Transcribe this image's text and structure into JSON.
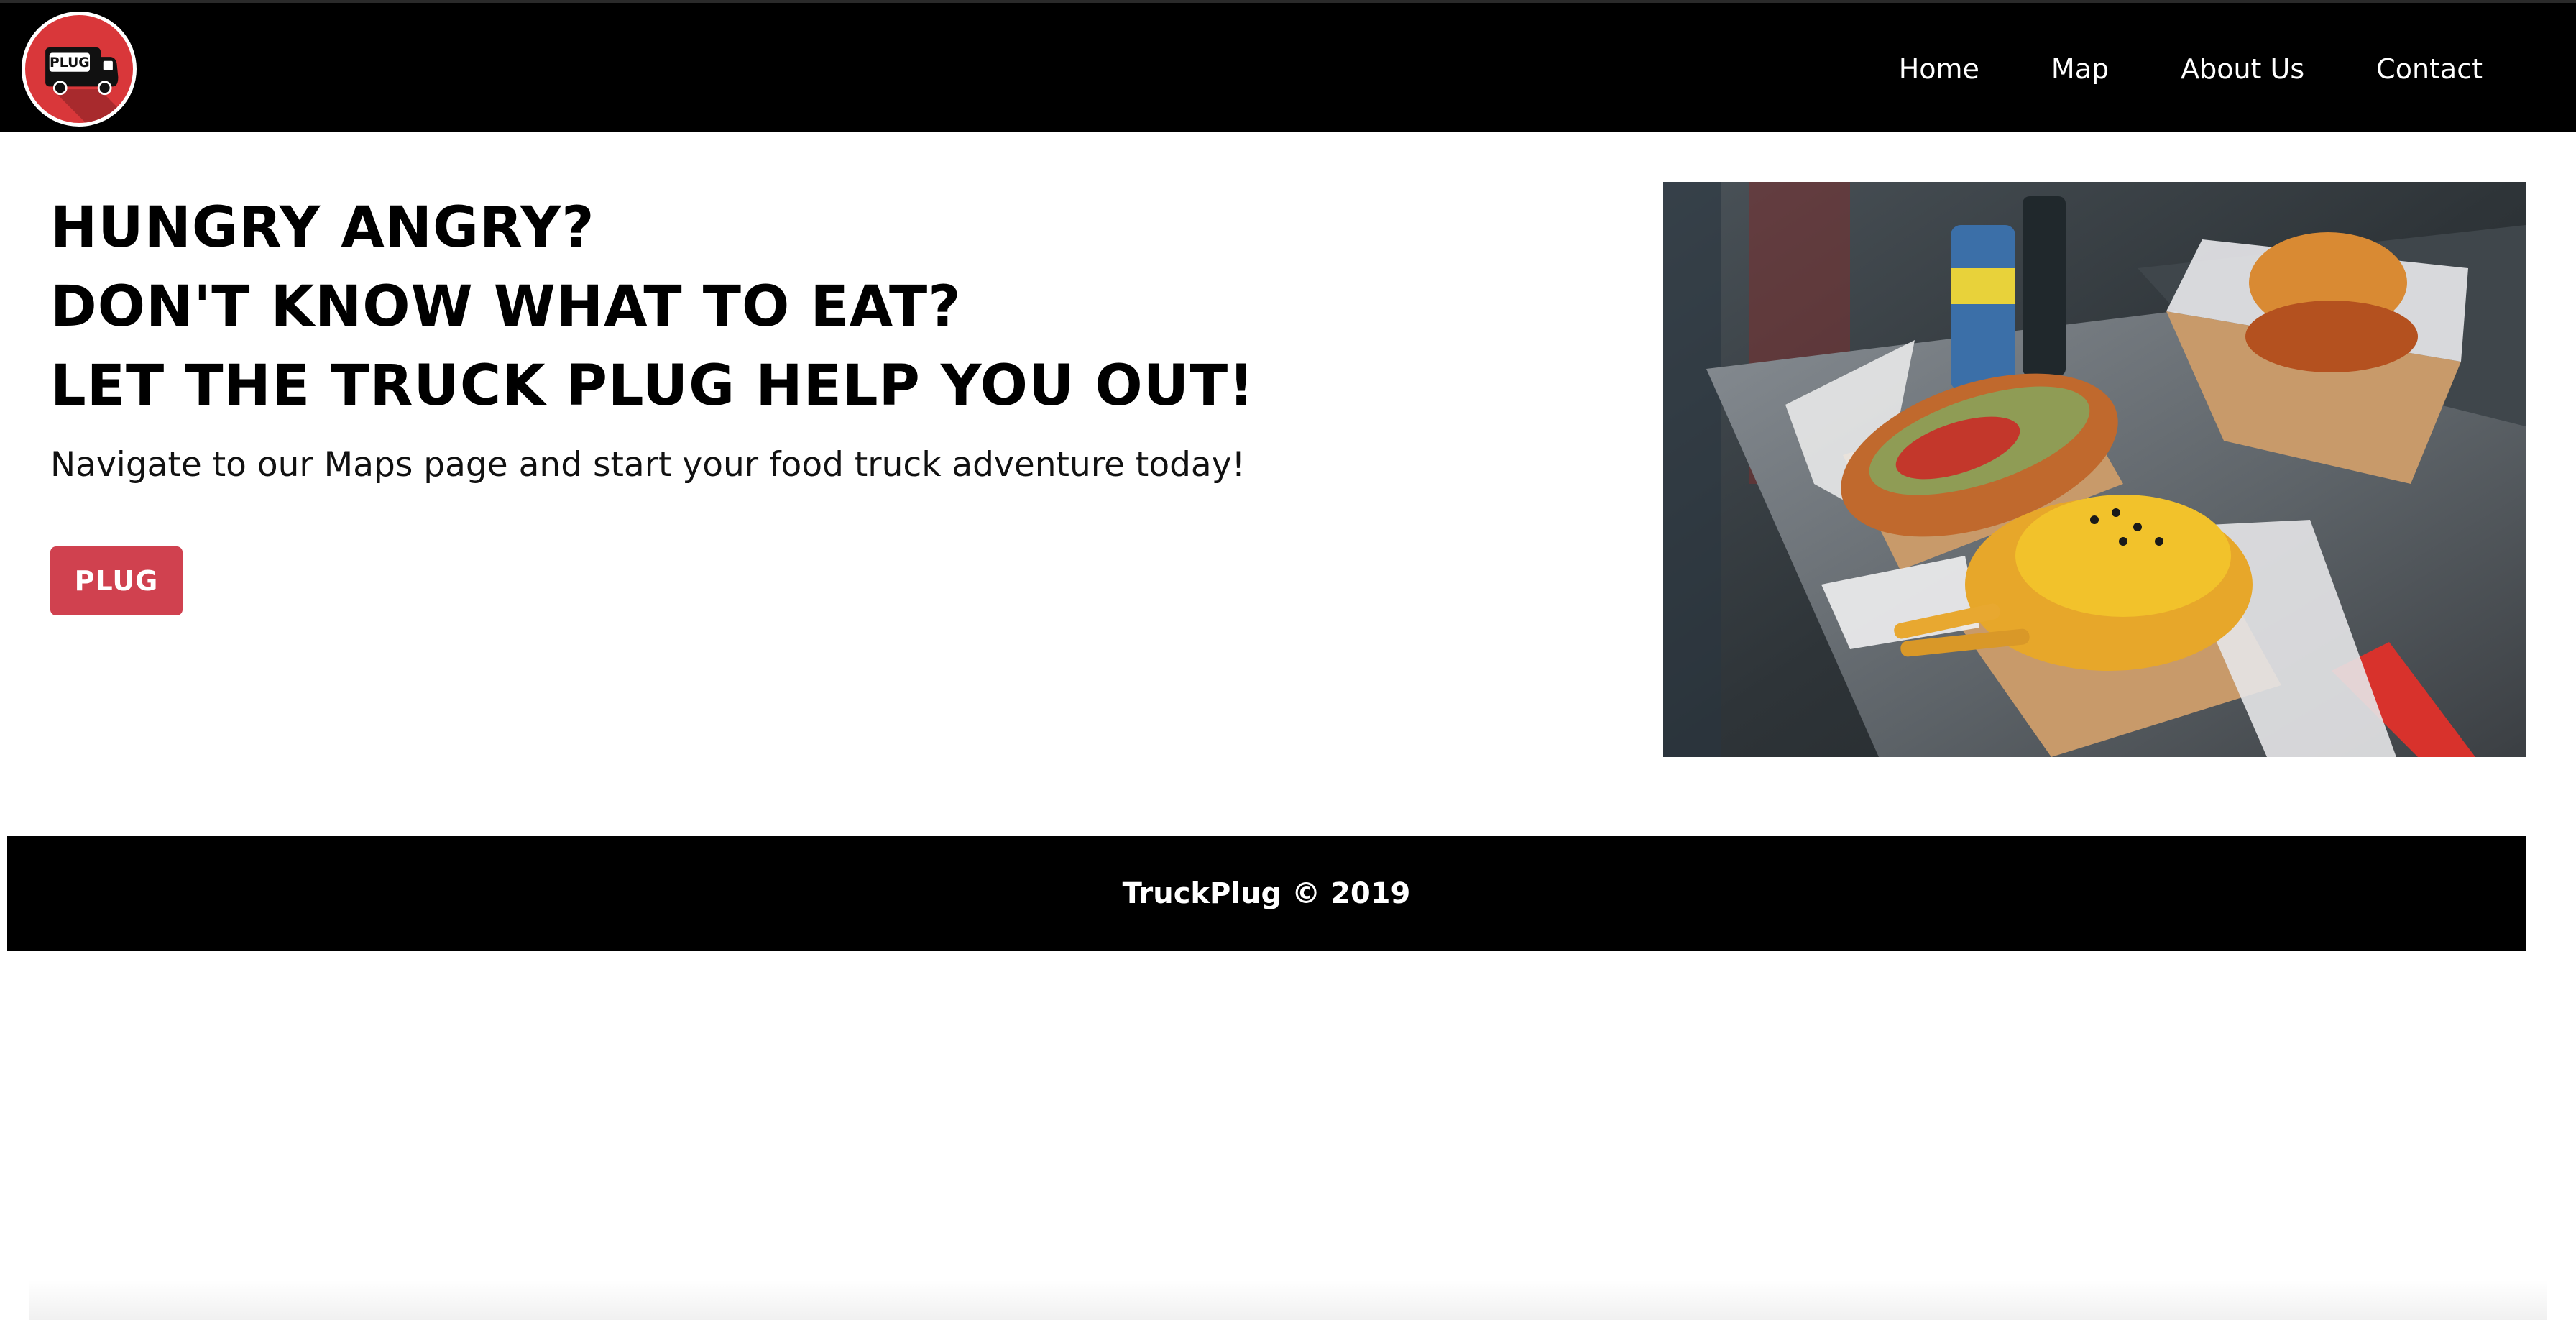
{
  "brand": {
    "logo_text": "PLUG",
    "logo_icon": "food-truck-icon",
    "accent_color": "#d9373a"
  },
  "nav": {
    "items": [
      {
        "label": "Home"
      },
      {
        "label": "Map"
      },
      {
        "label": "About Us"
      },
      {
        "label": "Contact"
      }
    ]
  },
  "hero": {
    "headline_lines": [
      "HUNGRY ANGRY?",
      "DON'T KNOW WHAT TO EAT?",
      "LET THE TRUCK PLUG HELP YOU OUT!"
    ],
    "subtext": "Navigate to our Maps page and start your food truck adventure today!",
    "button_label": "PLUG",
    "button_color": "#d0414f",
    "image_subject": "food-truck-meal-photo"
  },
  "footer": {
    "text": "TruckPlug © 2019"
  }
}
